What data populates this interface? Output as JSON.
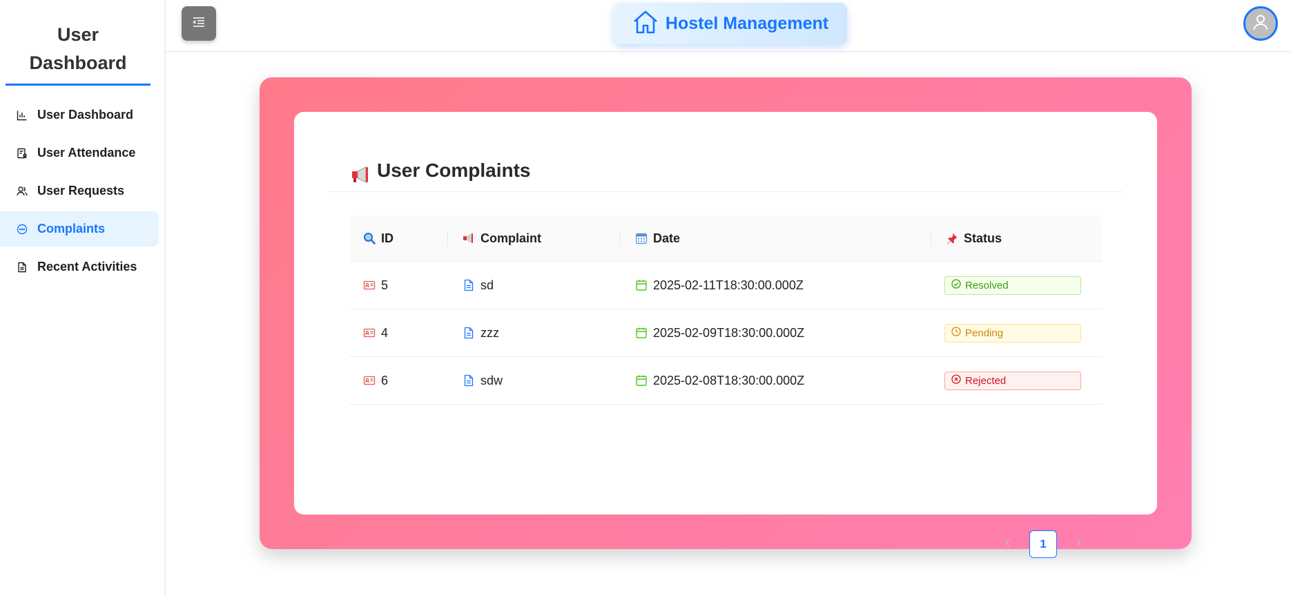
{
  "sidebar": {
    "title_line1": "User",
    "title_line2": "Dashboard",
    "items": [
      {
        "label": "User Dashboard",
        "icon": "bar-chart-icon"
      },
      {
        "label": "User Attendance",
        "icon": "attendance-icon"
      },
      {
        "label": "User Requests",
        "icon": "users-icon"
      },
      {
        "label": "Complaints",
        "icon": "chat-icon",
        "active": true
      },
      {
        "label": "Recent Activities",
        "icon": "file-icon"
      }
    ]
  },
  "header": {
    "brand": "Hostel Management",
    "menu_icon": "menu-fold-icon",
    "avatar_icon": "user-icon"
  },
  "complaints": {
    "title": "User Complaints",
    "columns": {
      "id": "ID",
      "complaint": "Complaint",
      "date": "Date",
      "status": "Status"
    },
    "rows": [
      {
        "id": "5",
        "complaint": "sd",
        "date": "2025-02-11T18:30:00.000Z",
        "status": "Resolved"
      },
      {
        "id": "4",
        "complaint": "zzz",
        "date": "2025-02-09T18:30:00.000Z",
        "status": "Pending"
      },
      {
        "id": "6",
        "complaint": "sdw",
        "date": "2025-02-08T18:30:00.000Z",
        "status": "Rejected"
      }
    ],
    "pagination": {
      "current_page": "1"
    }
  },
  "colors": {
    "accent": "#1677ff",
    "pink_from": "#ff7a8a",
    "pink_to": "#ff7fb2",
    "resolved": "#389e0d",
    "pending": "#d48806",
    "rejected": "#cf1322"
  }
}
